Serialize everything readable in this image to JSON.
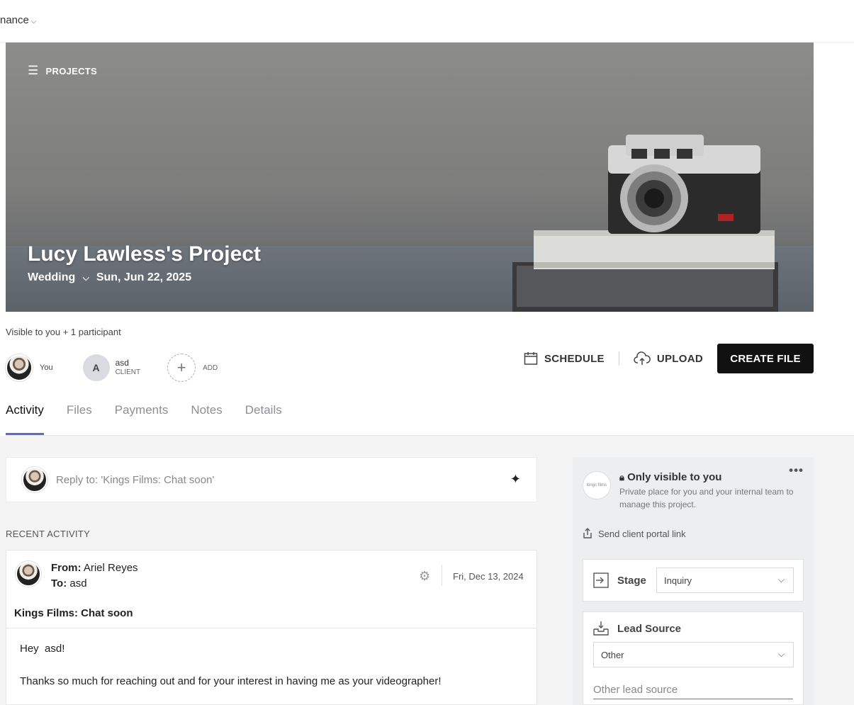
{
  "topbar": {
    "menu_label": "nance",
    "menu_chevron": "⌵"
  },
  "hero": {
    "nav_label": "PROJECTS",
    "title": "Lucy Lawless's Project",
    "event_type": "Wedding",
    "date": "Sun, Jun 22, 2025"
  },
  "participants": {
    "visibility": "Visible to you + 1 participant",
    "you_label": "You",
    "client_initial": "A",
    "client_name": "asd",
    "client_role": "CLIENT",
    "add_label": "ADD"
  },
  "actions": {
    "schedule": "SCHEDULE",
    "upload": "UPLOAD",
    "create_file": "CREATE FILE"
  },
  "tabs": [
    {
      "label": "Activity",
      "active": true
    },
    {
      "label": "Files",
      "active": false
    },
    {
      "label": "Payments",
      "active": false
    },
    {
      "label": "Notes",
      "active": false
    },
    {
      "label": "Details",
      "active": false
    }
  ],
  "reply": {
    "placeholder": "Reply to: 'Kings Films: Chat soon'"
  },
  "recent_activity_label": "RECENT ACTIVITY",
  "message": {
    "from_label": "From:",
    "from": "Ariel Reyes",
    "to_label": "To:",
    "to": "asd",
    "date": "Fri, Dec 13, 2024",
    "subject": "Kings Films: Chat soon",
    "greeting": "Hey  asd!",
    "body": "Thanks so much for reaching out and for your interest in having me as your videographer!"
  },
  "sidebar": {
    "logo_text": "kings films",
    "private_title": "Only visible to you",
    "private_desc": "Private place for you and your internal team to manage this project.",
    "portal_link": "Send client portal link",
    "stage_label": "Stage",
    "stage_value": "Inquiry",
    "lead_source_label": "Lead Source",
    "lead_source_value": "Other",
    "other_lead_placeholder": "Other lead source"
  },
  "colors": {
    "tab_active_underline": "#5b6bc9",
    "create_button": "#111111"
  }
}
